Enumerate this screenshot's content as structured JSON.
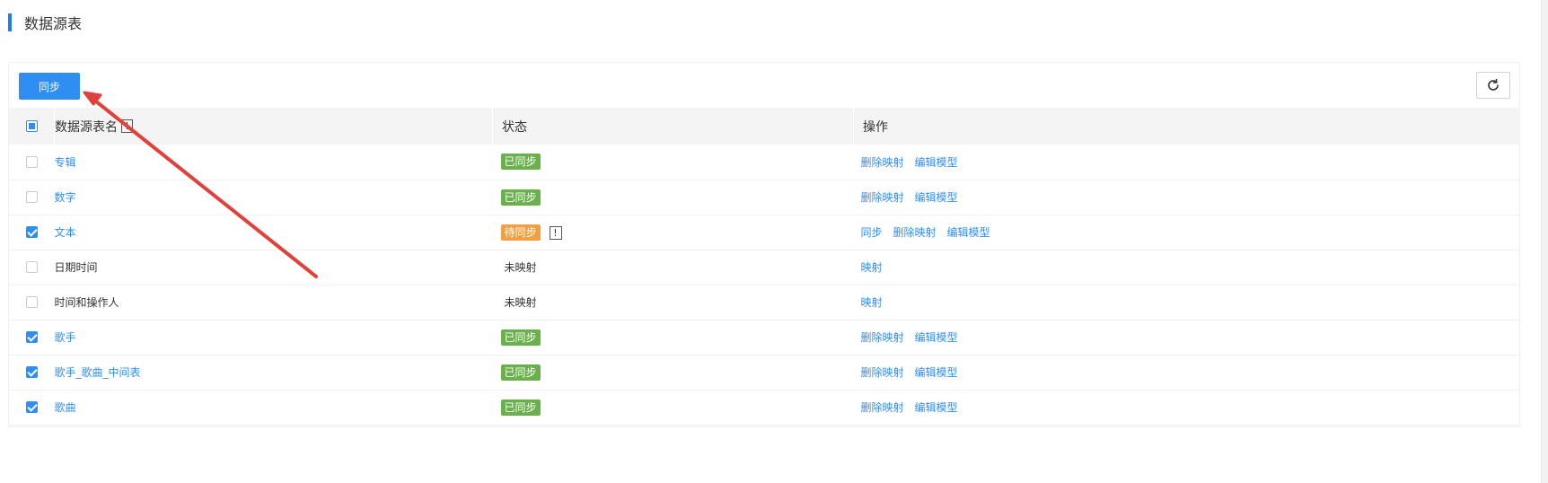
{
  "page": {
    "title": "数据源表"
  },
  "toolbar": {
    "sync_label": "同步",
    "refresh_icon": "refresh-icon"
  },
  "table": {
    "columns": {
      "name": "数据源表名",
      "name_hint": "!",
      "status": "状态",
      "actions": "操作"
    },
    "select_all_state": "indeterminate",
    "rows": [
      {
        "name": "专辑",
        "name_link": true,
        "checked": false,
        "status": "已同步",
        "status_type": "badge-green",
        "actions": [
          "删除映射",
          "编辑模型"
        ]
      },
      {
        "name": "数字",
        "name_link": true,
        "checked": false,
        "status": "已同步",
        "status_type": "badge-green",
        "actions": [
          "删除映射",
          "编辑模型"
        ]
      },
      {
        "name": "文本",
        "name_link": true,
        "checked": true,
        "status": "待同步",
        "status_type": "badge-orange",
        "warn": "!",
        "actions": [
          "同步",
          "删除映射",
          "编辑模型"
        ]
      },
      {
        "name": "日期时间",
        "name_link": false,
        "checked": false,
        "status": "未映射",
        "status_type": "text",
        "actions": [
          "映射"
        ]
      },
      {
        "name": "时间和操作人",
        "name_link": false,
        "checked": false,
        "status": "未映射",
        "status_type": "text",
        "actions": [
          "映射"
        ]
      },
      {
        "name": "歌手",
        "name_link": true,
        "checked": true,
        "status": "已同步",
        "status_type": "badge-green",
        "actions": [
          "删除映射",
          "编辑模型"
        ]
      },
      {
        "name": "歌手_歌曲_中间表",
        "name_link": true,
        "checked": true,
        "status": "已同步",
        "status_type": "badge-green",
        "actions": [
          "删除映射",
          "编辑模型"
        ]
      },
      {
        "name": "歌曲",
        "name_link": true,
        "checked": true,
        "status": "已同步",
        "status_type": "badge-green",
        "actions": [
          "删除映射",
          "编辑模型"
        ]
      }
    ]
  },
  "colors": {
    "accent": "#2f8ef2",
    "title_bar": "#1e7ee3",
    "badge_green": "#6ab04c",
    "badge_orange": "#f0a040",
    "annotation_arrow": "#e0413a"
  }
}
